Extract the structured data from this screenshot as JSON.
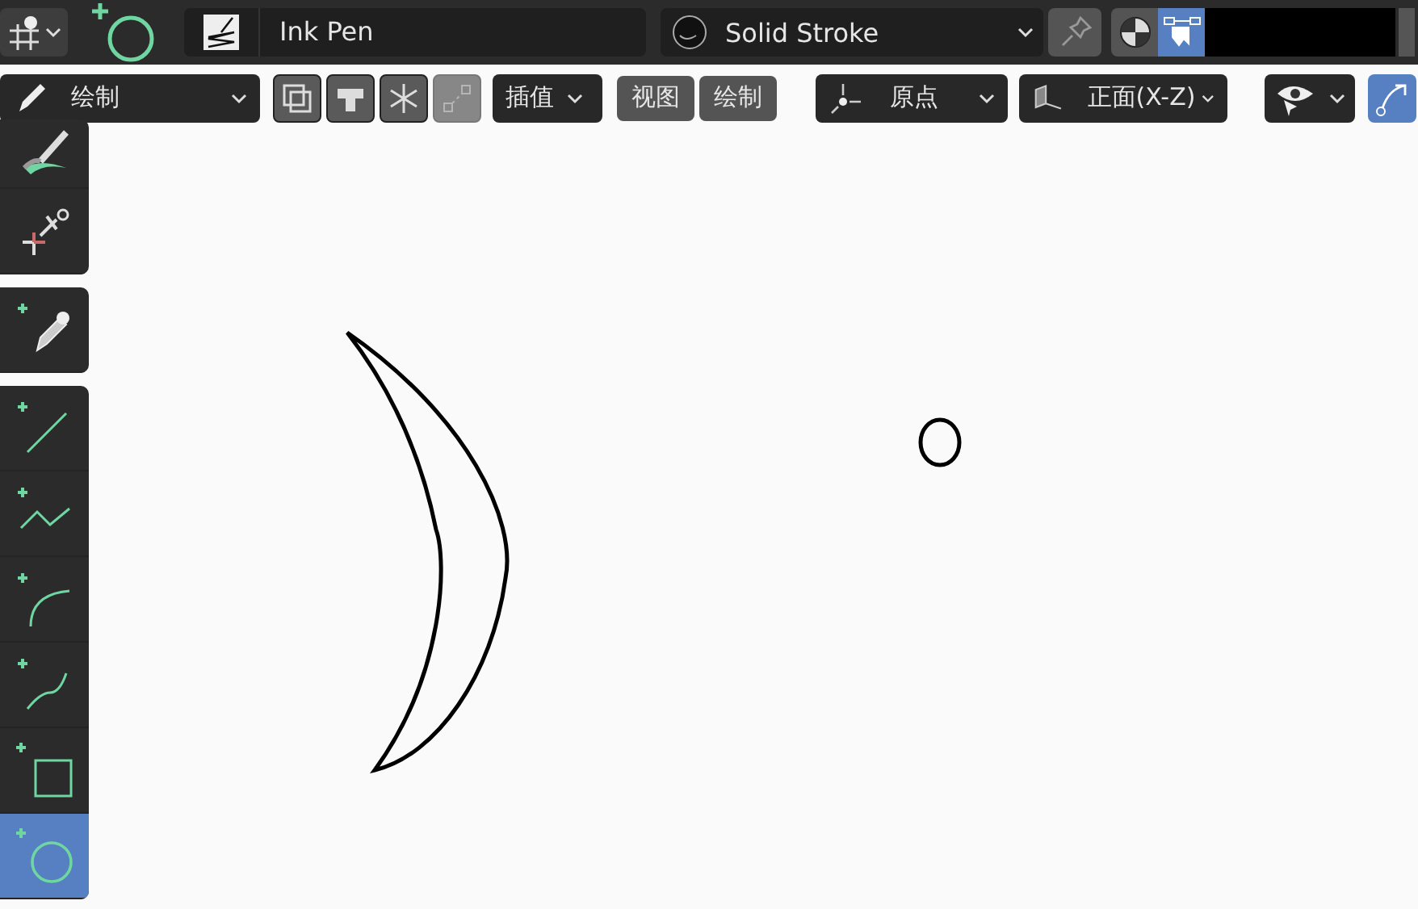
{
  "header": {
    "brush": {
      "name": "Ink Pen"
    },
    "material": {
      "name": "Solid Stroke"
    },
    "pin": {
      "on": false
    },
    "view_buttons": [
      {
        "kind": "shading",
        "selected": false
      },
      {
        "kind": "overlay",
        "selected": true
      }
    ]
  },
  "tool_settings": {
    "mode": "绘制",
    "icon_buttons": [
      {
        "kind": "layers",
        "disabled": false
      },
      {
        "kind": "weight",
        "disabled": false
      },
      {
        "kind": "freeze",
        "disabled": false
      },
      {
        "kind": "points",
        "disabled": true
      }
    ],
    "interpolate": "插值",
    "buttons": [
      "视图",
      "绘制"
    ],
    "origin": "原点",
    "plane": "正面(X-Z)",
    "toggles": [
      {
        "kind": "visibility",
        "on": false
      },
      {
        "kind": "curve",
        "on": true
      }
    ]
  },
  "toolbar": {
    "groups": [
      {
        "tools": [
          {
            "kind": "brush",
            "selected": false
          },
          {
            "kind": "cutter",
            "selected": false
          }
        ]
      },
      {
        "tools": [
          {
            "kind": "eyedropper",
            "selected": false
          }
        ]
      },
      {
        "tools": [
          {
            "kind": "line",
            "selected": false
          },
          {
            "kind": "polyline",
            "selected": false
          },
          {
            "kind": "arc",
            "selected": false
          },
          {
            "kind": "curve",
            "selected": false
          },
          {
            "kind": "box",
            "selected": false
          },
          {
            "kind": "circle",
            "selected": true
          }
        ]
      }
    ]
  }
}
